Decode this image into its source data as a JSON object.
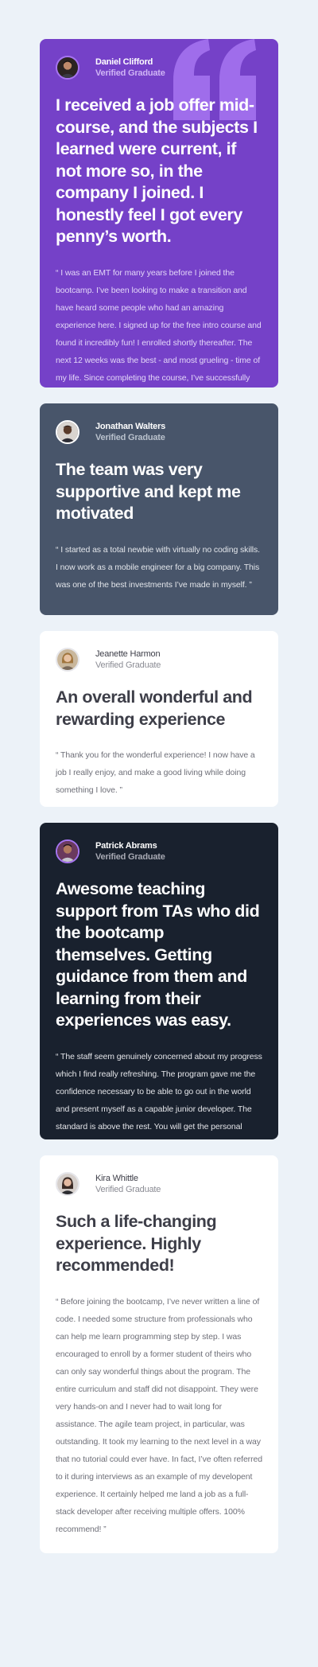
{
  "testimonials": [
    {
      "name": "Daniel Clifford",
      "status": "Verified Graduate",
      "headline": "I received a job offer mid-course, and the subjects I learned were current, if not more so, in the company I joined. I honestly feel I got every penny’s worth.",
      "body": "“ I was an EMT for many years before I joined the bootcamp. I’ve been looking to make a transition and have heard some people who had an amazing experience here. I signed up for the free intro course and found it incredibly fun! I enrolled shortly thereafter. The next 12 weeks was the best - and most grueling - time of my life. Since completing the course, I’ve successfully switched careers, working as a Software Engineer at a VR startup. ”",
      "avatar_icon": "person-avatar-icon",
      "theme": "purple"
    },
    {
      "name": "Jonathan Walters",
      "status": "Verified Graduate",
      "headline": "The team was very supportive and kept me motivated",
      "body": "“ I started as a total newbie with virtually no coding skills. I now work as a mobile engineer for a big company. This was one of the best investments I’ve made in myself. ”",
      "avatar_icon": "person-avatar-icon",
      "theme": "slate"
    },
    {
      "name": "Jeanette Harmon",
      "status": "Verified Graduate",
      "headline": "An overall wonderful and rewarding experience",
      "body": "“ Thank you for the wonderful experience! I now have a job I really enjoy, and make a good living while doing something I love. ”",
      "avatar_icon": "person-avatar-icon",
      "theme": "white"
    },
    {
      "name": "Patrick Abrams",
      "status": "Verified Graduate",
      "headline": "Awesome teaching support from TAs who did the bootcamp themselves. Getting guidance from them and learning from their experiences was easy.",
      "body": "“ The staff seem genuinely concerned about my progress which I find really refreshing. The program gave me the confidence necessary to be able to go out in the world and present myself as a capable junior developer. The standard is above the rest. You will get the personal attention you need from an incredible community of smart and amazing people. ”",
      "avatar_icon": "person-avatar-icon",
      "theme": "dark"
    },
    {
      "name": "Kira Whittle",
      "status": "Verified Graduate",
      "headline": "Such a life-changing experience. Highly recommended!",
      "body": "“ Before joining the bootcamp, I’ve never written a line of code. I needed some structure from professionals who can help me learn programming step by step. I was encouraged to enroll by a former student of theirs who can only say wonderful things about the program. The entire curriculum and staff did not disappoint. They were very hands-on and I never had to wait long for assistance. The agile team project, in particular, was outstanding. It took my learning to the next level in a way that no tutorial could ever have. In fact, I’ve often referred to it during interviews as an example of my developent experience. It certainly helped me land a job as a full-stack developer after receiving multiple offers. 100% recommend! ”",
      "avatar_icon": "person-avatar-icon",
      "theme": "white"
    }
  ],
  "decoration": {
    "quote_icon": "quotation-mark-icon"
  },
  "colors": {
    "page_background": "#ecf2f8",
    "purple": "#7541c8",
    "slate": "#48556a",
    "white": "#ffffff",
    "dark": "#19212e",
    "quote_mark": "#a775f1"
  }
}
